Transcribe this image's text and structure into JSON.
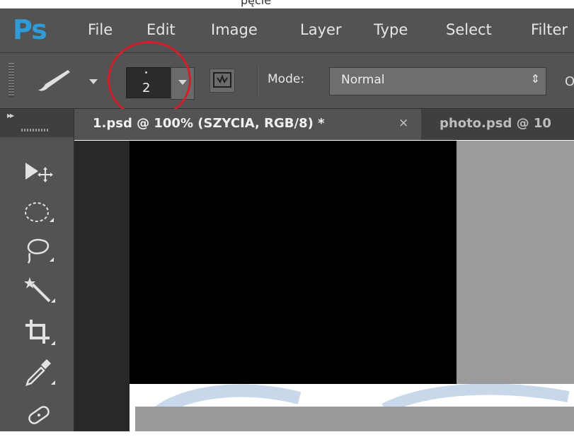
{
  "page_top_text": "pęcie",
  "app": {
    "logo": "Ps"
  },
  "menu": [
    "File",
    "Edit",
    "Image",
    "Layer",
    "Type",
    "Select",
    "Filter"
  ],
  "options": {
    "brush_size": "2",
    "mode_label": "Mode:",
    "mode_value": "Normal",
    "mode_arrow": "⇕",
    "edge_glyph": "O",
    "highlight_color": "#d0202a"
  },
  "tabs": [
    {
      "title": "1.psd @ 100% (SZYCIA, RGB/8) *",
      "close": "×",
      "active": true
    },
    {
      "title": "photo.psd @ 10",
      "active": false
    }
  ],
  "toolbar": {
    "collapse": "▸▸",
    "tools": [
      "move-tool",
      "elliptical-marquee-tool",
      "lasso-tool",
      "magic-wand-tool",
      "crop-tool",
      "eyedropper-tool",
      "spot-healing-tool"
    ]
  }
}
